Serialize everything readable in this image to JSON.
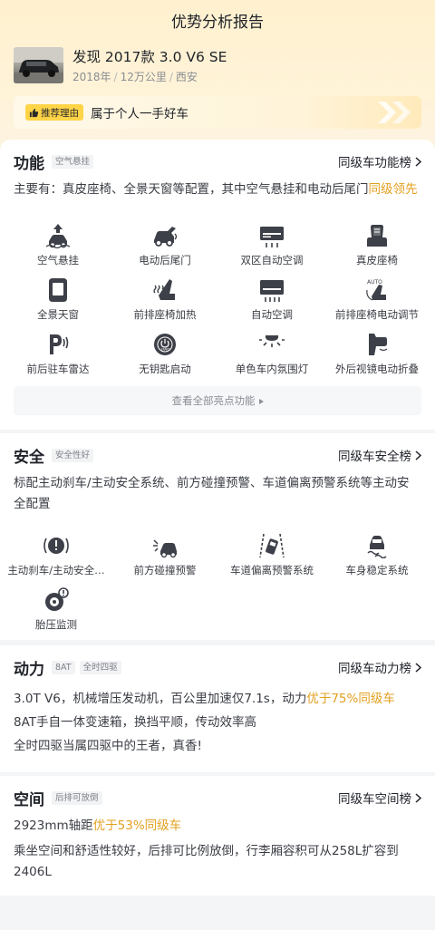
{
  "header": {
    "title": "优势分析报告"
  },
  "car": {
    "name": "发现 2017款 3.0 V6 SE",
    "year": "2018年",
    "mileage": "12万公里",
    "city": "西安",
    "separator": "/"
  },
  "reason": {
    "tag": "推荐理由",
    "text": "属于个人一手好车"
  },
  "function": {
    "title": "功能",
    "chip": "空气悬挂",
    "rank_link": "同级车功能榜",
    "desc_main": "主要有：真皮座椅、全景天窗等配置，其中空气悬挂和电动后尾门",
    "desc_highlight": "同级领先",
    "features": [
      {
        "label": "空气悬挂",
        "icon": "air-suspension-icon"
      },
      {
        "label": "电动后尾门",
        "icon": "power-tailgate-icon"
      },
      {
        "label": "双区自动空调",
        "icon": "dual-zone-ac-icon"
      },
      {
        "label": "真皮座椅",
        "icon": "leather-seat-icon"
      },
      {
        "label": "全景天窗",
        "icon": "panoramic-sunroof-icon"
      },
      {
        "label": "前排座椅加热",
        "icon": "seat-heating-icon"
      },
      {
        "label": "自动空调",
        "icon": "auto-ac-icon"
      },
      {
        "label": "前排座椅电动调节",
        "icon": "power-seat-icon"
      },
      {
        "label": "前后驻车雷达",
        "icon": "parking-radar-icon"
      },
      {
        "label": "无钥匙启动",
        "icon": "keyless-start-icon"
      },
      {
        "label": "单色车内氛围灯",
        "icon": "ambient-light-icon"
      },
      {
        "label": "外后视镜电动折叠",
        "icon": "mirror-fold-icon"
      }
    ],
    "more_label": "查看全部亮点功能"
  },
  "safety": {
    "title": "安全",
    "chip": "安全性好",
    "rank_link": "同级车安全榜",
    "desc": "标配主动刹车/主动安全系统、前方碰撞预警、车道偏离预警系统等主动安全配置",
    "features": [
      {
        "label": "主动刹车/主动安全…",
        "icon": "active-brake-icon"
      },
      {
        "label": "前方碰撞预警",
        "icon": "collision-warning-icon"
      },
      {
        "label": "车道偏离预警系统",
        "icon": "lane-departure-icon"
      },
      {
        "label": "车身稳定系统",
        "icon": "stability-control-icon"
      },
      {
        "label": "胎压监测",
        "icon": "tire-pressure-icon"
      }
    ]
  },
  "power": {
    "title": "动力",
    "chips": [
      "8AT",
      "全时四驱"
    ],
    "rank_link": "同级车动力榜",
    "line1_main": "3.0T V6，机械增压发动机，百公里加速仅7.1s，动力",
    "line1_highlight": "优于75%同级车",
    "line2": "8AT手自一体变速箱，换挡平顺，传动效率高",
    "line3": "全时四驱当属四驱中的王者，真香!"
  },
  "space": {
    "title": "空间",
    "chip": "后排可放倒",
    "rank_link": "同级车空间榜",
    "line1_main": "2923mm轴距",
    "line1_highlight": "优于53%同级车",
    "line2": "乘坐空间和舒适性较好，后排可比例放倒，行李厢容积可从258L扩容到2406L"
  },
  "colors": {
    "accent": "#e3a020",
    "tag_yellow": "#ffd447",
    "icon": "#3d4048"
  }
}
